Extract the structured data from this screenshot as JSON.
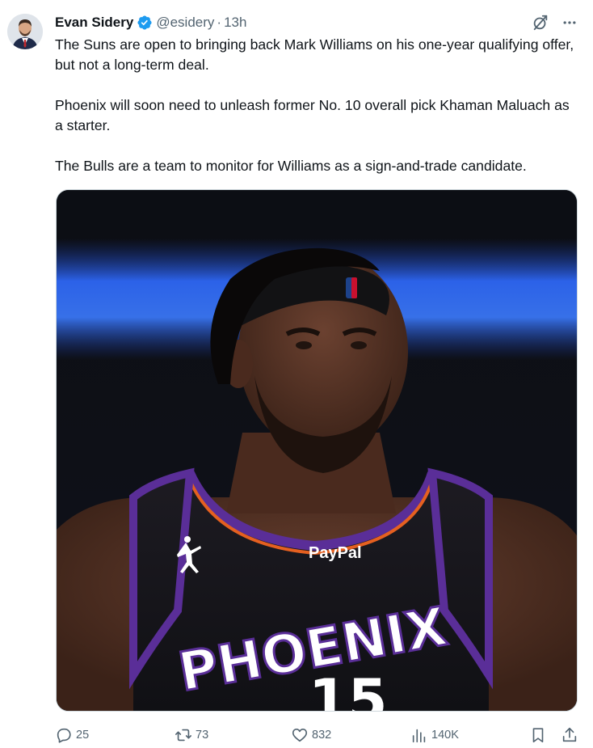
{
  "author": {
    "display_name": "Evan Sidery",
    "handle": "@esidery",
    "separator": "·",
    "time": "13h"
  },
  "tweet": {
    "paragraphs": [
      "The Suns are open to bringing back Mark Williams on his one-year qualifying offer, but not a long-term deal.",
      "Phoenix will soon need to unleash former No. 10 overall pick Khaman Maluach as a starter.",
      "The Bulls are a team to monitor for Williams as a sign-and-trade candidate."
    ]
  },
  "media": {
    "jersey_text": "PHOENIX",
    "jersey_number": "15",
    "sponsor": "PayPal"
  },
  "actions": {
    "replies": "25",
    "reposts": "73",
    "likes": "832",
    "views": "140K"
  },
  "icons": {
    "verified": "verified-badge-icon",
    "grok": "grok-icon",
    "more": "more-icon",
    "reply": "reply-icon",
    "repost": "repost-icon",
    "like": "heart-icon",
    "views": "analytics-icon",
    "bookmark": "bookmark-icon",
    "share": "share-icon"
  },
  "colors": {
    "text": "#0f1419",
    "secondary": "#536471",
    "verified_blue": "#1d9bf0",
    "jersey_purple": "#5a2e98",
    "jersey_orange": "#e56020"
  }
}
